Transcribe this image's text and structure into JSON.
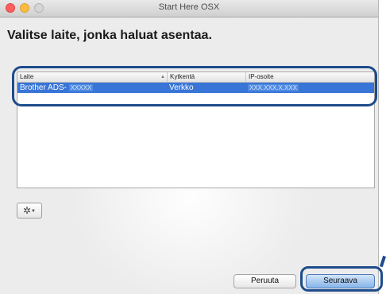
{
  "window": {
    "title": "Start Here OSX"
  },
  "heading": "Valitse laite, jonka haluat asentaa.",
  "table": {
    "columns": [
      "Laite",
      "Kytkentä",
      "IP-osoite"
    ],
    "rows": [
      {
        "device_name": "Brother ADS-",
        "device_model_masked": "XXXXX",
        "connection": "Verkko",
        "ip": "XXX.XXX.X.XXX"
      }
    ]
  },
  "toolbar": {
    "gear_icon": "gear-icon"
  },
  "buttons": {
    "cancel": "Peruuta",
    "next": "Seuraava"
  },
  "colors": {
    "selection": "#3875d7",
    "highlight_outline": "#1e4c8c",
    "default_button": "#86b4ea"
  }
}
